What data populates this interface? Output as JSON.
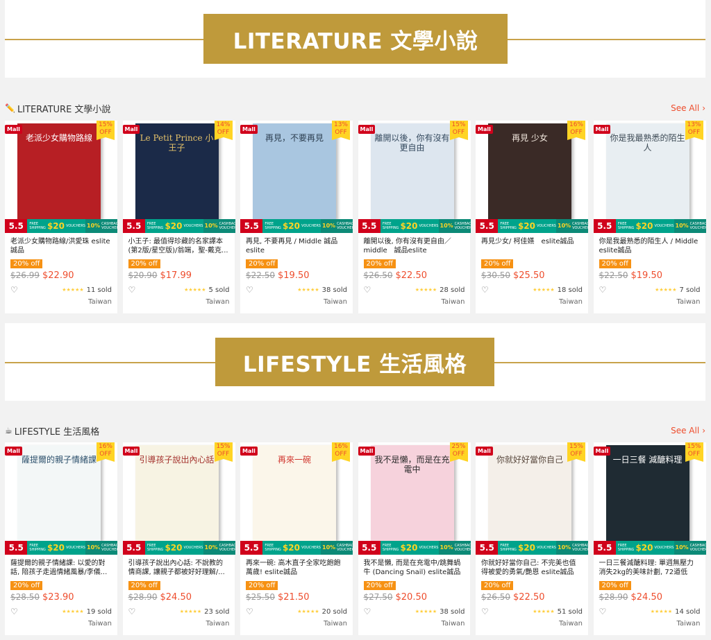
{
  "banners": [
    {
      "plaque": "LITERATURE 文學小說"
    },
    {
      "plaque": "LIFESTYLE 生活風格"
    }
  ],
  "sections": [
    {
      "icon": "pencil-icon",
      "title": "LITERATURE 文學小說",
      "see_all": "See All",
      "products": [
        {
          "name": "老派少女購物路線/洪愛珠 eslite誠品",
          "cover_text": "老派少女購物路線",
          "cover_color": "#b71f24",
          "cover_fg": "#ffffff",
          "discount_pct": "15%",
          "discount_off": "OFF",
          "tag": "20% off",
          "orig": "$26.99",
          "price": "$22.90",
          "sold": "11 sold",
          "loc": "Taiwan"
        },
        {
          "name": "小王子: 最值得珍藏的名家譯本 (第2版/星空版)/翁端，聖-戴克...",
          "cover_text": "Le Petit Prince 小王子",
          "cover_color": "#1b2a48",
          "cover_fg": "#e6c36a",
          "discount_pct": "14%",
          "discount_off": "OFF",
          "tag": "20% off",
          "orig": "$20.90",
          "price": "$17.99",
          "sold": "5 sold",
          "loc": "Taiwan"
        },
        {
          "name": "再見, 不要再見 / Middle 誠品 eslite",
          "cover_text": "再見，不要再見",
          "cover_color": "#a9c6e0",
          "cover_fg": "#2c3e50",
          "discount_pct": "13%",
          "discount_off": "OFF",
          "tag": "20% off",
          "orig": "$22.50",
          "price": "$19.50",
          "sold": "38 sold",
          "loc": "Taiwan"
        },
        {
          "name": "離開以後, 你有沒有更自由／ middle　誠品eslite",
          "cover_text": "離開以後，你有沒有更自由",
          "cover_color": "#dde6ef",
          "cover_fg": "#34495e",
          "discount_pct": "15%",
          "discount_off": "OFF",
          "tag": "20% off",
          "orig": "$26.50",
          "price": "$22.50",
          "sold": "28 sold",
          "loc": "Taiwan"
        },
        {
          "name": "再見少女/ 柯佳嬿　eslite誠品",
          "cover_text": "再見 少女",
          "cover_color": "#3a2a26",
          "cover_fg": "#f0e6dc",
          "discount_pct": "16%",
          "discount_off": "OFF",
          "tag": "20% off",
          "orig": "$30.50",
          "price": "$25.50",
          "sold": "18 sold",
          "loc": "Taiwan"
        },
        {
          "name": "你是我最熟悉的陌生人 / Middle eslite誠品",
          "cover_text": "你是我最熟悉的陌生人",
          "cover_color": "#e8eef2",
          "cover_fg": "#3d4a55",
          "discount_pct": "13%",
          "discount_off": "OFF",
          "tag": "20% off",
          "orig": "$22.50",
          "price": "$19.50",
          "sold": "7 sold",
          "loc": "Taiwan"
        }
      ]
    },
    {
      "icon": "coffee-icon",
      "title": "LIFESTYLE 生活風格",
      "see_all": "See All",
      "products": [
        {
          "name": "薩提爾的親子情緒課: 以愛的對話, 陪孩子走過情緒風暴/李儀...",
          "cover_text": "薩提爾的親子情緒課",
          "cover_color": "#f3f7f7",
          "cover_fg": "#2b4f6b",
          "discount_pct": "16%",
          "discount_off": "OFF",
          "tag": "20% off",
          "orig": "$28.50",
          "price": "$23.90",
          "sold": "19 sold",
          "loc": "Taiwan"
        },
        {
          "name": "引導孩子說出內心話: 不說教的情商課, 讓親子都被好好理解/...",
          "cover_text": "引導孩子說出內心話",
          "cover_color": "#f7f3e3",
          "cover_fg": "#a3312c",
          "discount_pct": "15%",
          "discount_off": "OFF",
          "tag": "20% off",
          "orig": "$28.90",
          "price": "$24.50",
          "sold": "23 sold",
          "loc": "Taiwan"
        },
        {
          "name": "再來一碗: 高木直子全家吃飽飽萬歲! eslite誠品",
          "cover_text": "再來一碗",
          "cover_color": "#fbf6ea",
          "cover_fg": "#d0342c",
          "discount_pct": "16%",
          "discount_off": "OFF",
          "tag": "20% off",
          "orig": "$25.50",
          "price": "$21.50",
          "sold": "20 sold",
          "loc": "Taiwan"
        },
        {
          "name": "我不是懶, 而是在充電中/跳舞蝸牛 (Dancing Snail) eslite誠品",
          "cover_text": "我不是懶，而是在充電中",
          "cover_color": "#f6d2dc",
          "cover_fg": "#2c2c2c",
          "discount_pct": "25%",
          "discount_off": "OFF",
          "tag": "20% off",
          "orig": "$27.50",
          "price": "$20.50",
          "sold": "38 sold",
          "loc": "Taiwan"
        },
        {
          "name": "你就好好當你自己: 不完美也值得被愛的勇氣/艷恩 eslite誠品",
          "cover_text": "你就好好當你自己",
          "cover_color": "#f4efe9",
          "cover_fg": "#5a4a3f",
          "discount_pct": "15%",
          "discount_off": "OFF",
          "tag": "20% off",
          "orig": "$26.50",
          "price": "$22.50",
          "sold": "51 sold",
          "loc": "Taiwan"
        },
        {
          "name": "一日三餐減醣料理: 單週無壓力消失2kg的美味計劃, 72道低醣...",
          "cover_text": "一日三餐 減醣料理",
          "cover_color": "#1f2b33",
          "cover_fg": "#ffffff",
          "discount_pct": "15%",
          "discount_off": "OFF",
          "tag": "20% off",
          "orig": "$28.90",
          "price": "$24.50",
          "sold": "14 sold",
          "loc": "Taiwan"
        }
      ]
    }
  ],
  "labels": {
    "mall": "Mall",
    "promo_55": "5.5",
    "promo_ship_small": "FREE SHIPPING",
    "promo_ship_amount": "$20",
    "promo_ship_sub": "VOUCHERS",
    "promo_cash_pct": "10%",
    "promo_cash_sub": "CASHBACK VOUCHERS",
    "stars": "★★★★★"
  },
  "colors": {
    "gold": "#bf9a3b",
    "accent": "#ee4d2d",
    "mall_red": "#d0011b",
    "tag_orange": "#f69113"
  }
}
